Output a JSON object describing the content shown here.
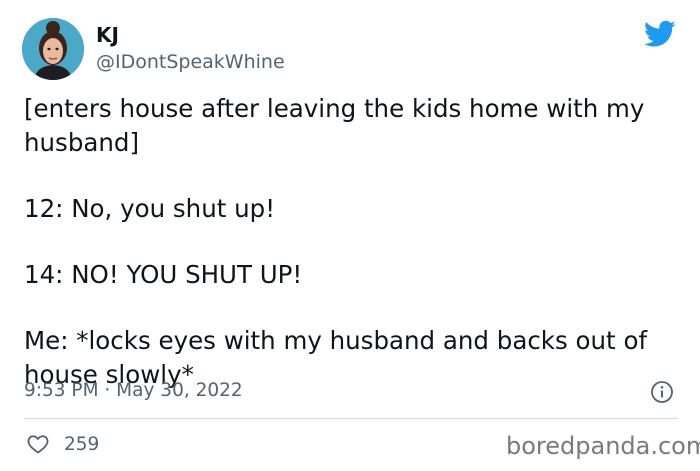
{
  "author": {
    "name": "KJ",
    "handle": "@IDontSpeakWhine",
    "avatar_icon": "profile-photo"
  },
  "platform_icon": "twitter-bird-icon",
  "brand_color": "#1d9bf0",
  "tweet": {
    "paragraphs": [
      "[enters house after leaving the kids home with my husband]",
      "12: No, you shut up!",
      "14: NO! YOU SHUT UP!",
      "Me: *locks eyes with my husband and backs out of house slowly*"
    ],
    "timestamp": "9:53 PM · May 30, 2022",
    "likes": "259"
  },
  "watermark": "boredpanda.com"
}
